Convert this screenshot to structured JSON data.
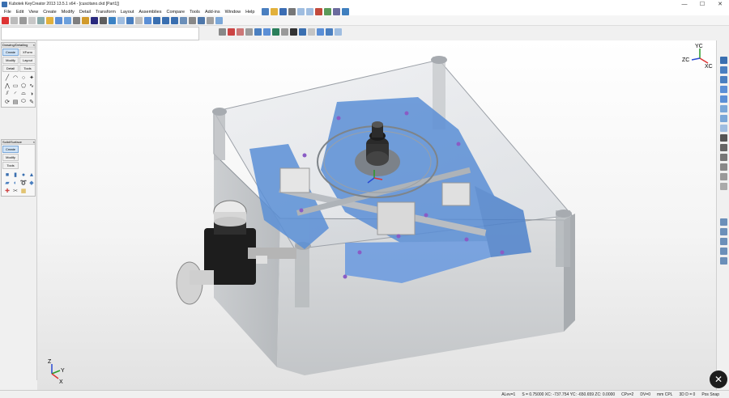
{
  "window": {
    "title": "Kubotek KeyCreator 2013 13.5.1 x64 - [cuscitano.ckd [Part1]]",
    "min": "—",
    "max": "☐",
    "close": "✕"
  },
  "menu": [
    "File",
    "Edit",
    "View",
    "Create",
    "Modify",
    "Detail",
    "Transform",
    "Layout",
    "Assemblies",
    "Compare",
    "Tools",
    "Add-ins",
    "Window",
    "Help"
  ],
  "palettes": {
    "drawing": {
      "header": "Drawing/Detailing",
      "buttons": [
        "Create",
        "XForm",
        "Modify",
        "Layout",
        "Detail",
        "Tools"
      ]
    },
    "solid": {
      "header": "Solid/Surface",
      "buttons": [
        "Create",
        "Modify",
        "Tools"
      ]
    }
  },
  "viewport": {
    "triad_top": {
      "y": "YC",
      "z": "ZC",
      "x": "XC"
    },
    "triad_bottom": {
      "z": "Z",
      "y": "Y",
      "x": "X"
    }
  },
  "status": {
    "level": "ALev=1",
    "coords": "S = 0.75000  XC: -737.754  YC: -650.659  ZC: 0.0000",
    "cplane": "CPx=2",
    "dview": "DV=0",
    "units": "mm  CPL",
    "depth": "3D  D = 0",
    "snap": "Pos Snap"
  },
  "colors": {
    "accent_blue": "#5b8fd6",
    "titlebar": "#ffffff",
    "viewport_top": "#ffffff",
    "viewport_bottom": "#e2e2e2"
  }
}
